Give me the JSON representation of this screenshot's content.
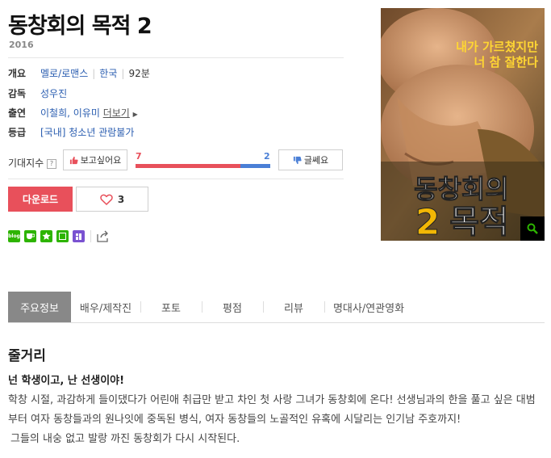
{
  "movie": {
    "title": "동창회의 목적 2",
    "year": "2016"
  },
  "info": {
    "overview_label": "개요",
    "genre": "멜로/로맨스",
    "country": "한국",
    "runtime": "92분",
    "director_label": "감독",
    "director": "성우진",
    "cast_label": "출연",
    "cast": "이철희, 이유미",
    "more_label": "더보기",
    "rating_label": "등급",
    "rating": "[국내] 청소년 관람불가"
  },
  "expect": {
    "label": "기대지수",
    "help_icon": "?",
    "want_label": "보고싶어요",
    "meh_label": "글쎄요",
    "want_count": "7",
    "meh_count": "2",
    "want_ratio": 0.78
  },
  "actions": {
    "download_label": "다운로드",
    "like_count": "3"
  },
  "poster": {
    "tagline_1": "내가 가르쳤지만",
    "tagline_2": "너 참 잘한다",
    "logo_line1": "동창회의",
    "logo_num": "2",
    "logo_line2": "목적"
  },
  "share": {
    "blog_label": "blog"
  },
  "tabs": [
    "주요정보",
    "배우/제작진",
    "포토",
    "평점",
    "리뷰",
    "명대사/연관영화"
  ],
  "synopsis": {
    "heading": "줄거리",
    "tagline": "넌 학생이고, 난 선생이야!",
    "line1": "학창 시절, 과감하게 들이댔다가 어린애 취급만 받고 차인 첫 사랑 그녀가 동창회에 온다! 선생님과의 한을 풀고 싶은 대범부터 여자 동창들과의 원나잇에 중독된 병식, 여자 동창들의 노골적인 유혹에 시달리는 인기남 주호까지!",
    "line2": "그들의 내숭 없고 발랑 까진 동창회가 다시 시작된다."
  },
  "colors": {
    "accent_red": "#e8505b",
    "accent_blue": "#4a7fd6",
    "link_blue": "#2a5db0"
  }
}
